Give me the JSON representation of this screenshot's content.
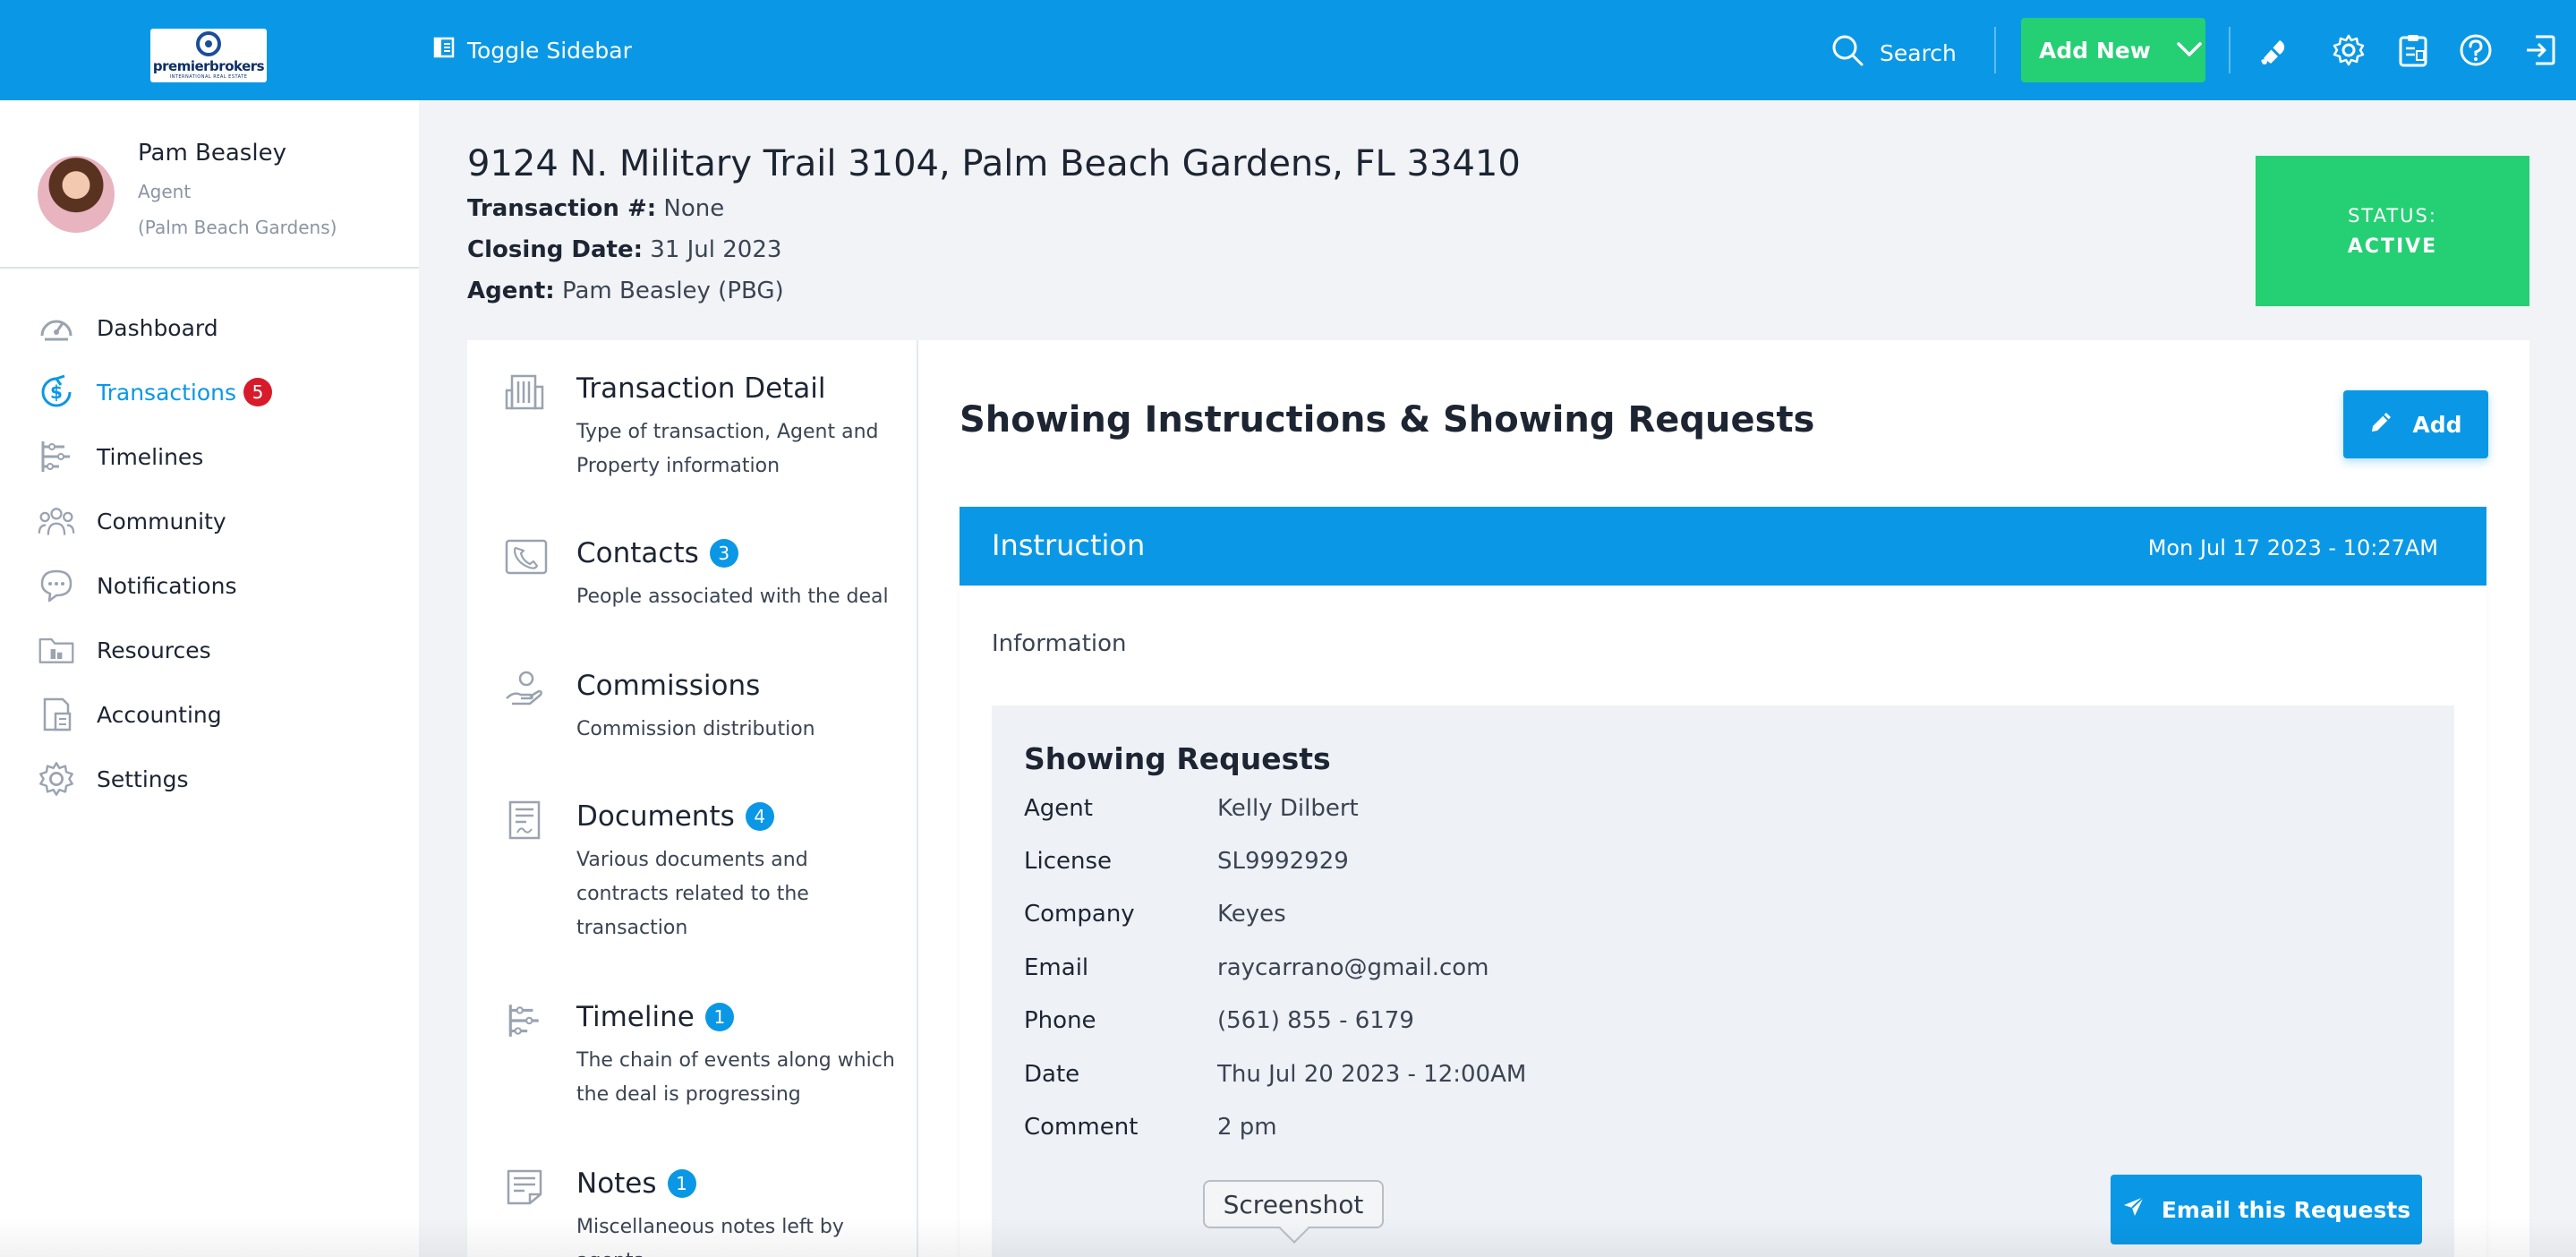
{
  "topbar": {
    "logo_text": "premierbrokers",
    "logo_sub": "INTERNATIONAL REAL ESTATE",
    "toggle_label": "Toggle Sidebar",
    "search_label": "Search",
    "add_new_label": "Add New",
    "icons": [
      "bell-icon",
      "gear-icon",
      "clipboard-icon",
      "help-icon",
      "logout-icon"
    ],
    "color": "#0a98e6"
  },
  "profile": {
    "name": "Pam Beasley",
    "role": "Agent",
    "office": "(Palm Beach Gardens)"
  },
  "nav": {
    "items": [
      {
        "label": "Dashboard",
        "icon": "speedometer-icon"
      },
      {
        "label": "Transactions",
        "icon": "dollar-icon",
        "badge": "5"
      },
      {
        "label": "Timelines",
        "icon": "timeline-icon"
      },
      {
        "label": "Community",
        "icon": "people-icon"
      },
      {
        "label": "Notifications",
        "icon": "chat-bubble-icon"
      },
      {
        "label": "Resources",
        "icon": "folder-icon"
      },
      {
        "label": "Accounting",
        "icon": "calculator-icon"
      },
      {
        "label": "Settings",
        "icon": "gear-icon"
      }
    ]
  },
  "transaction": {
    "address": "9124 N. Military Trail 3104, Palm Beach Gardens, FL 33410",
    "number_label": "Transaction #:",
    "number_value": "None",
    "closing_label": "Closing Date:",
    "closing_value": "31 Jul 2023",
    "agent_label": "Agent:",
    "agent_value": "Pam Beasley (PBG)",
    "status_label": "STATUS:",
    "status_value": "ACTIVE",
    "status_color": "#25cf74"
  },
  "sections": [
    {
      "title": "Transaction Detail",
      "desc": "Type of transaction, Agent and Property information",
      "icon": "building-icon"
    },
    {
      "title": "Contacts",
      "desc": "People associated with the deal",
      "badge": "3",
      "icon": "phone-book-icon"
    },
    {
      "title": "Commissions",
      "desc": "Commission distribution",
      "icon": "hand-coin-icon"
    },
    {
      "title": "Documents",
      "desc": "Various documents and contracts related to the transaction",
      "badge": "4",
      "icon": "document-icon"
    },
    {
      "title": "Timeline",
      "desc": "The chain of events along which the deal is progressing",
      "badge": "1",
      "icon": "timeline-icon"
    },
    {
      "title": "Notes",
      "desc": "Miscellaneous notes left by agents",
      "badge": "1",
      "icon": "note-icon"
    }
  ],
  "main": {
    "title": "Showing Instructions & Showing Requests",
    "add_label": "Add",
    "instruction_title": "Instruction",
    "instruction_date": "Mon Jul 17 2023 - 10:27AM",
    "information_label": "Information",
    "requests": {
      "title": "Showing Requests",
      "rows": [
        {
          "key": "Agent",
          "value": "Kelly Dilbert"
        },
        {
          "key": "License",
          "value": "SL9992929"
        },
        {
          "key": "Company",
          "value": "Keyes"
        },
        {
          "key": "Email",
          "value": "raycarrano@gmail.com"
        },
        {
          "key": "Phone",
          "value": "(561) 855 - 6179"
        },
        {
          "key": "Date",
          "value": "Thu Jul 20 2023 - 12:00AM"
        },
        {
          "key": "Comment",
          "value": "2 pm"
        }
      ],
      "email_button": "Email this Requests"
    }
  },
  "tooltip": "Screenshot"
}
